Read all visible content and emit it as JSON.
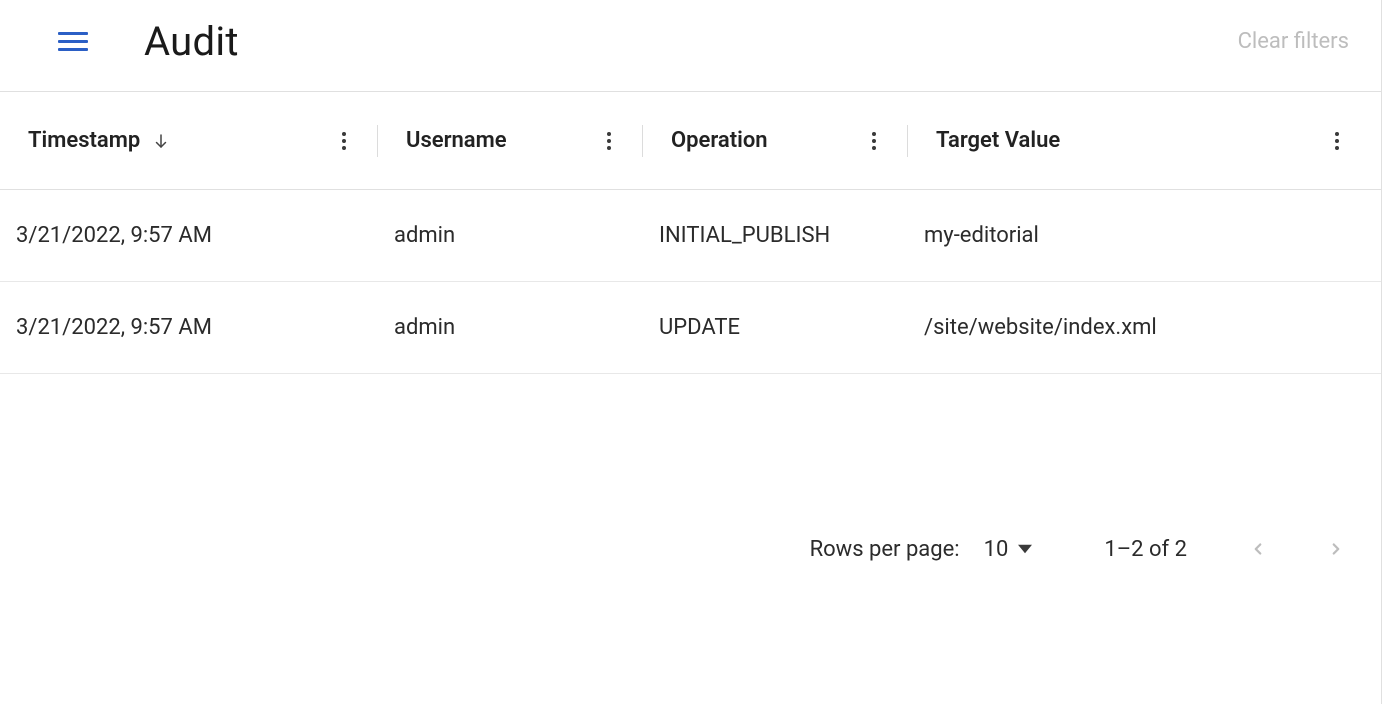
{
  "header": {
    "title": "Audit",
    "clear_filters": "Clear filters"
  },
  "table": {
    "columns": {
      "timestamp": "Timestamp",
      "username": "Username",
      "operation": "Operation",
      "target": "Target Value"
    },
    "sort": {
      "column": "timestamp",
      "direction": "desc"
    },
    "rows": [
      {
        "timestamp": "3/21/2022, 9:57 AM",
        "username": "admin",
        "operation": "INITIAL_PUBLISH",
        "target": "my-editorial"
      },
      {
        "timestamp": "3/21/2022, 9:57 AM",
        "username": "admin",
        "operation": "UPDATE",
        "target": "/site/website/index.xml"
      }
    ]
  },
  "pagination": {
    "rows_per_page_label": "Rows per page:",
    "rows_per_page_value": "10",
    "range": "1–2 of 2",
    "prev_enabled": false,
    "next_enabled": false
  }
}
